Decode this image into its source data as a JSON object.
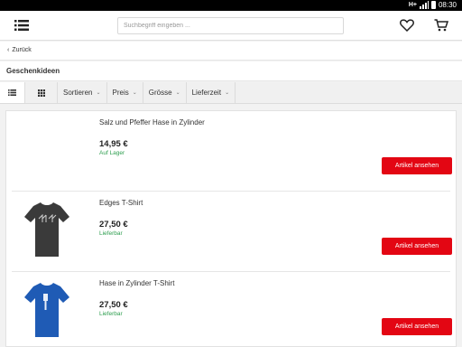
{
  "statusbar": {
    "network": "H+",
    "time": "08:30"
  },
  "header": {
    "search_placeholder": "Suchbegriff eingeben ..."
  },
  "nav": {
    "back_label": "Zurück"
  },
  "page": {
    "title": "Geschenkideen"
  },
  "filters": [
    {
      "label": "Sortieren"
    },
    {
      "label": "Preis"
    },
    {
      "label": "Grösse"
    },
    {
      "label": "Lieferzeit"
    }
  ],
  "products": [
    {
      "name": "Salz und Pfeffer Hase in Zylinder",
      "price": "14,95 €",
      "availability": "Auf Lager",
      "button": "Artikel ansehen"
    },
    {
      "name": "Edges T-Shirt",
      "price": "27,50 €",
      "availability": "Lieferbar",
      "button": "Artikel ansehen",
      "shirt_color": "#3a3a3a"
    },
    {
      "name": "Hase in Zylinder T-Shirt",
      "price": "27,50 €",
      "availability": "Lieferbar",
      "button": "Artikel ansehen",
      "shirt_color": "#1f5bb5"
    }
  ],
  "colors": {
    "accent": "#e30613",
    "availability": "#2e9e4f"
  }
}
